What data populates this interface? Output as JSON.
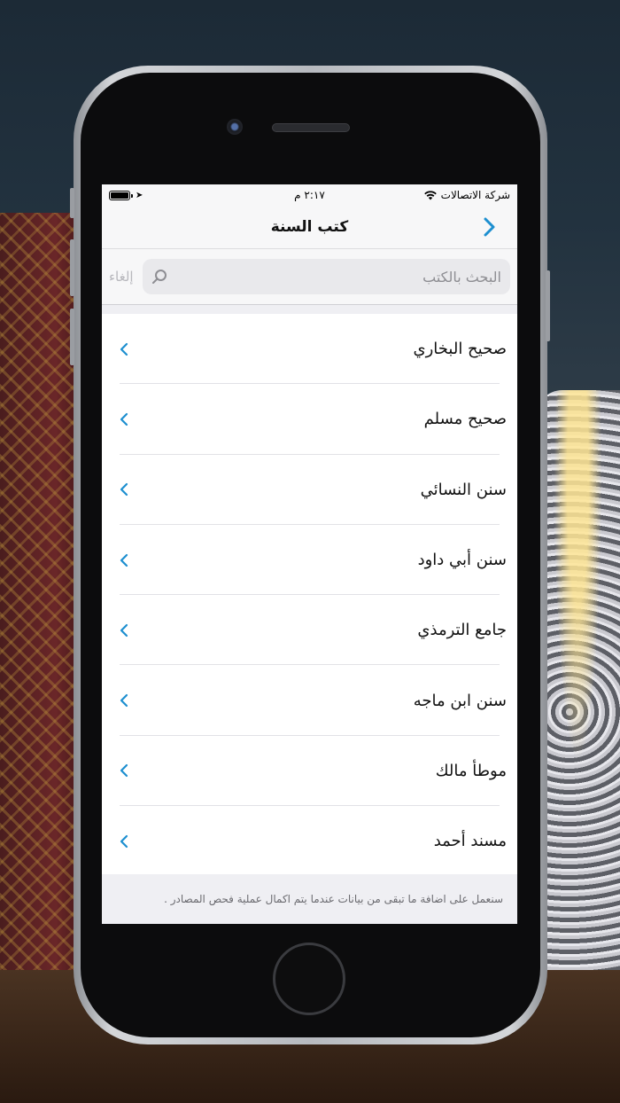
{
  "statusbar": {
    "carrier": "شركة الاتصالات",
    "time": "٢:١٧ م"
  },
  "navbar": {
    "title": "كتب السنة",
    "back_icon": "chevron-right-icon"
  },
  "search": {
    "placeholder": "البحث بالكتب",
    "value": "",
    "cancel_label": "إلغاء"
  },
  "books": [
    {
      "label": "صحيح البخاري"
    },
    {
      "label": "صحيح مسلم"
    },
    {
      "label": "سنن النسائي"
    },
    {
      "label": "سنن أبي داود"
    },
    {
      "label": "جامع الترمذي"
    },
    {
      "label": "سنن ابن ماجه"
    },
    {
      "label": "موطأ مالك"
    },
    {
      "label": "مسند أحمد"
    }
  ],
  "footer": {
    "note": "سنعمل على اضافة ما تبقى من بيانات عندما يتم اكمال عملية فحص المصادر ."
  },
  "colors": {
    "accent": "#1d8fd0",
    "bar_bg": "#f7f7f8",
    "group_bg": "#efeff3"
  }
}
